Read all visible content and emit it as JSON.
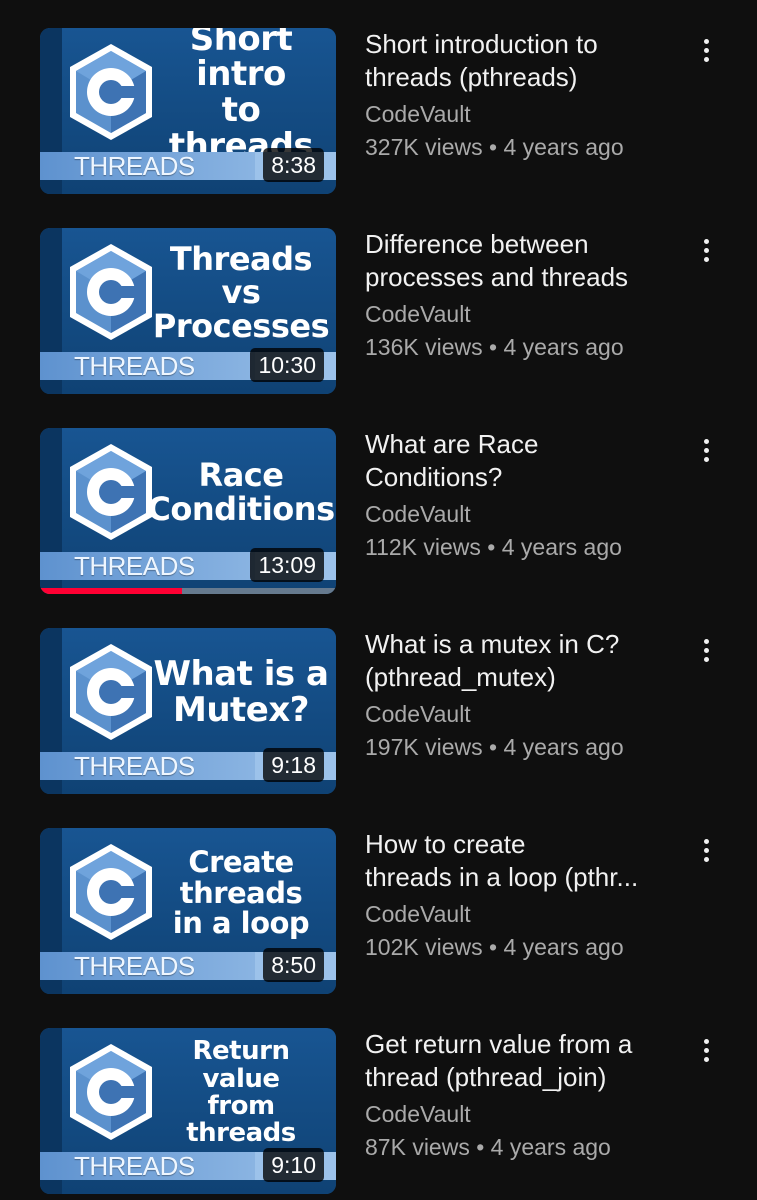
{
  "videos": [
    {
      "thumb_title": "Short intro\nto threads",
      "thumb_title_size": 34,
      "band_label": "THREADS",
      "duration": "8:38",
      "title": "Short introduction to\nthreads (pthreads)",
      "channel": "CodeVault",
      "stats": "327K views • 4 years ago",
      "watched_fraction": 0
    },
    {
      "thumb_title": "Threads\nvs\nProcesses",
      "thumb_title_size": 32,
      "band_label": "THREADS",
      "duration": "10:30",
      "title": "Difference between\nprocesses and threads",
      "channel": "CodeVault",
      "stats": "136K views • 4 years ago",
      "watched_fraction": 0
    },
    {
      "thumb_title": "Race\nConditions",
      "thumb_title_size": 32,
      "band_label": "THREADS",
      "duration": "13:09",
      "title": "What are Race\nConditions?",
      "channel": "CodeVault",
      "stats": "112K views • 4 years ago",
      "watched_fraction": 0.48
    },
    {
      "thumb_title": "What is a\nMutex?",
      "thumb_title_size": 34,
      "band_label": "THREADS",
      "duration": "9:18",
      "title": "What is a mutex in C?\n(pthread_mutex)",
      "channel": "CodeVault",
      "stats": "197K views • 4 years ago",
      "watched_fraction": 0
    },
    {
      "thumb_title": "Create\nthreads\nin a loop",
      "thumb_title_size": 29,
      "band_label": "THREADS",
      "duration": "8:50",
      "title": "How to create\nthreads in a loop (pthr...",
      "channel": "CodeVault",
      "stats": "102K views • 4 years ago",
      "watched_fraction": 0
    },
    {
      "thumb_title": "Return value\nfrom threads",
      "thumb_title_size": 26,
      "band_label": "THREADS",
      "duration": "9:10",
      "title": "Get return value from a\nthread (pthread_join)",
      "channel": "CodeVault",
      "stats": "87K views • 4 years ago",
      "watched_fraction": 0
    }
  ],
  "icons": {
    "language_logo": "c-language-hexagon-icon",
    "menu": "more-vertical-icon"
  },
  "colors": {
    "background": "#0f0f0f",
    "thumbnail_blue": "#114578",
    "band_light_blue": "#9cc2ea",
    "progress_red": "#ff0033",
    "secondary_text": "#aaaaaa"
  }
}
